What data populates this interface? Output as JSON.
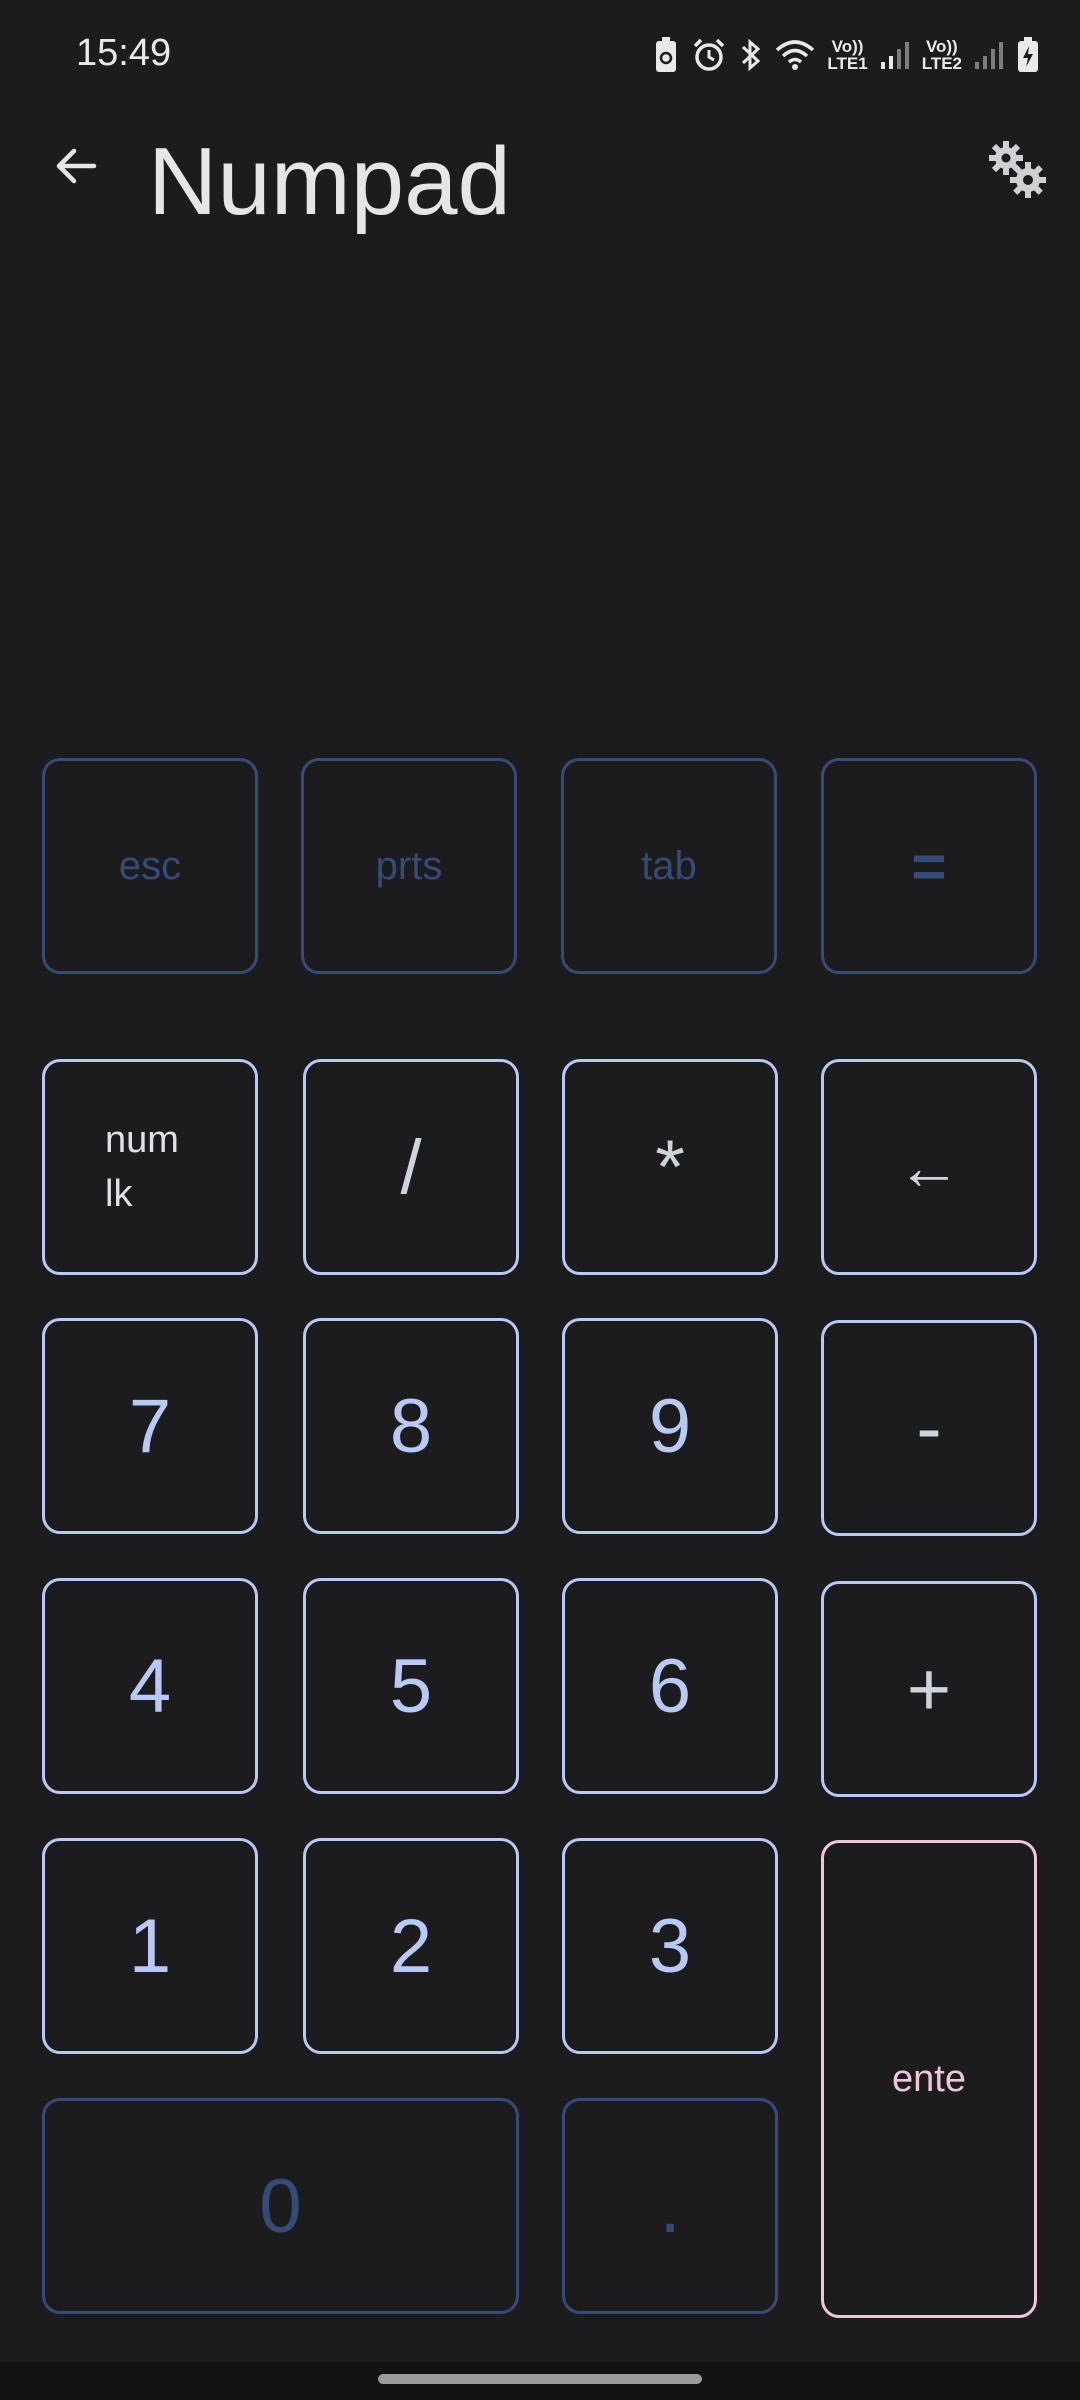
{
  "status": {
    "time": "15:49",
    "sim1": {
      "top": "Vo))",
      "bottom": "LTE1"
    },
    "sim2": {
      "top": "Vo))",
      "bottom": "LTE2"
    }
  },
  "appbar": {
    "title": "Numpad",
    "back_icon": "arrow-left-icon",
    "settings_icon": "gears-icon"
  },
  "keys": {
    "esc": "esc",
    "prts": "prts",
    "tab": "tab",
    "equals": "=",
    "numlock_line1": "num",
    "numlock_line2": "lk",
    "divide": "/",
    "multiply": "*",
    "backspace": "←",
    "k7": "7",
    "k8": "8",
    "k9": "9",
    "minus": "-",
    "k4": "4",
    "k5": "5",
    "k6": "6",
    "plus": "+",
    "k1": "1",
    "k2": "2",
    "k3": "3",
    "enter": "ente",
    "k0": "0",
    "dot": "."
  },
  "colors": {
    "background": "#1c1c1e",
    "key_active": "#b7c9f4",
    "key_dim": "#354b78",
    "key_enter": "#f0c6dc"
  }
}
